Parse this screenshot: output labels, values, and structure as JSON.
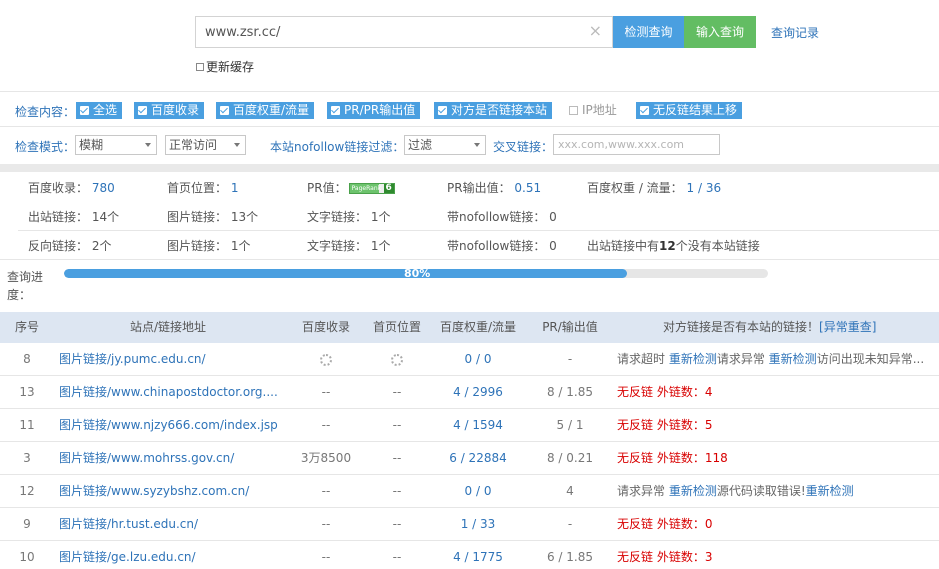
{
  "search": {
    "value": "www.zsr.cc/",
    "clear_glyph": "×",
    "detect_label": "检测查询",
    "input_label": "输入查询",
    "history_label": "查询记录",
    "refresh_cache_label": "更新缓存"
  },
  "options": {
    "content_label": "检查内容：",
    "checkboxes": [
      {
        "label": "全选",
        "checked": true
      },
      {
        "label": "百度收录",
        "checked": true
      },
      {
        "label": "百度权重/流量",
        "checked": true
      },
      {
        "label": "PR/PR输出值",
        "checked": true
      },
      {
        "label": "对方是否链接本站",
        "checked": true
      },
      {
        "label": "IP地址",
        "checked": false
      },
      {
        "label": "无反链结果上移",
        "checked": true
      }
    ],
    "mode_label": "检查模式：",
    "mode_value": "模糊",
    "access_value": "正常访问",
    "nofollow_label": "本站nofollow链接过滤：",
    "nofollow_value": "过滤",
    "cross_label": "交叉链接：",
    "cross_placeholder": "xxx.com,www.xxx.com"
  },
  "stats": {
    "baidu_index_label": "百度收录：",
    "baidu_index_value": "780",
    "home_pos_label": "首页位置：",
    "home_pos_value": "1",
    "pr_label": "PR值：",
    "pr_value": "6",
    "pr_output_label": "PR输出值：",
    "pr_output_value": "0.51",
    "weight_label": "百度权重 / 流量：",
    "weight_value": "1 / 36",
    "outbound_label": "出站链接：",
    "outbound_value": "14个",
    "img_link_label": "图片链接：",
    "img_link_value": "13个",
    "text_link_label": "文字链接：",
    "text_link_value": "1个",
    "nofollow_link_label": "带nofollow链接：",
    "nofollow_link_value": "0",
    "back_label": "反向链接：",
    "back_value": "2个",
    "img_link2_value": "1个",
    "text_link2_value": "1个",
    "nofollow_link2_value": "0",
    "note_prefix": "出站链接中有",
    "note_num": "12",
    "note_suffix": "个没有本站链接"
  },
  "progress": {
    "label": "查询进度：",
    "percent": 80,
    "text": "80%"
  },
  "table": {
    "headers": {
      "index": "序号",
      "site": "站点/链接地址",
      "baidu": "百度收录",
      "home": "首页位置",
      "weight": "百度权重/流量",
      "pr": "PR/输出值",
      "backlink": "对方链接是否有本站的链接！",
      "recheck": "[异常重查]"
    },
    "rows": [
      {
        "idx": "8",
        "site": "图片链接/jy.pumc.edu.cn/",
        "baidu": "",
        "home": "",
        "weight": "0 / 0",
        "pr": "-",
        "status_type": "timeout",
        "status": [
          "请求超时 ",
          "重新检测",
          "请求异常 ",
          "重新检测",
          "访问出现未知异常..."
        ]
      },
      {
        "idx": "13",
        "site": "图片链接/www.chinapostdoctor.org....",
        "baidu": "--",
        "home": "--",
        "weight": "4 / 2996",
        "pr": "8 / 1.85",
        "status_type": "nolink",
        "status": [
          "无反链 ",
          "外链数：4"
        ]
      },
      {
        "idx": "11",
        "site": "图片链接/www.njzy666.com/index.jsp",
        "baidu": "--",
        "home": "--",
        "weight": "4 / 1594",
        "pr": "5 / 1",
        "status_type": "nolink",
        "status": [
          "无反链 ",
          "外链数：5"
        ]
      },
      {
        "idx": "3",
        "site": "图片链接/www.mohrss.gov.cn/",
        "baidu": "3万8500",
        "home": "--",
        "weight": "6 / 22884",
        "pr": "8 / 0.21",
        "status_type": "nolink",
        "status": [
          "无反链 ",
          "外链数：118"
        ]
      },
      {
        "idx": "12",
        "site": "图片链接/www.syzybshz.com.cn/",
        "baidu": "--",
        "home": "--",
        "weight": "0 / 0",
        "pr": "4",
        "status_type": "error",
        "status": [
          "请求异常 ",
          "重新检测",
          "源代码读取错误!",
          "重新检测"
        ]
      },
      {
        "idx": "9",
        "site": "图片链接/hr.tust.edu.cn/",
        "baidu": "--",
        "home": "--",
        "weight": "1 / 33",
        "pr": "-",
        "status_type": "nolink",
        "status": [
          "无反链 ",
          "外链数：0"
        ]
      },
      {
        "idx": "10",
        "site": "图片链接/ge.lzu.edu.cn/",
        "baidu": "--",
        "home": "--",
        "weight": "4 / 1775",
        "pr": "6 / 1.85",
        "status_type": "nolink",
        "status": [
          "无反链 ",
          "外链数：3"
        ]
      }
    ]
  }
}
